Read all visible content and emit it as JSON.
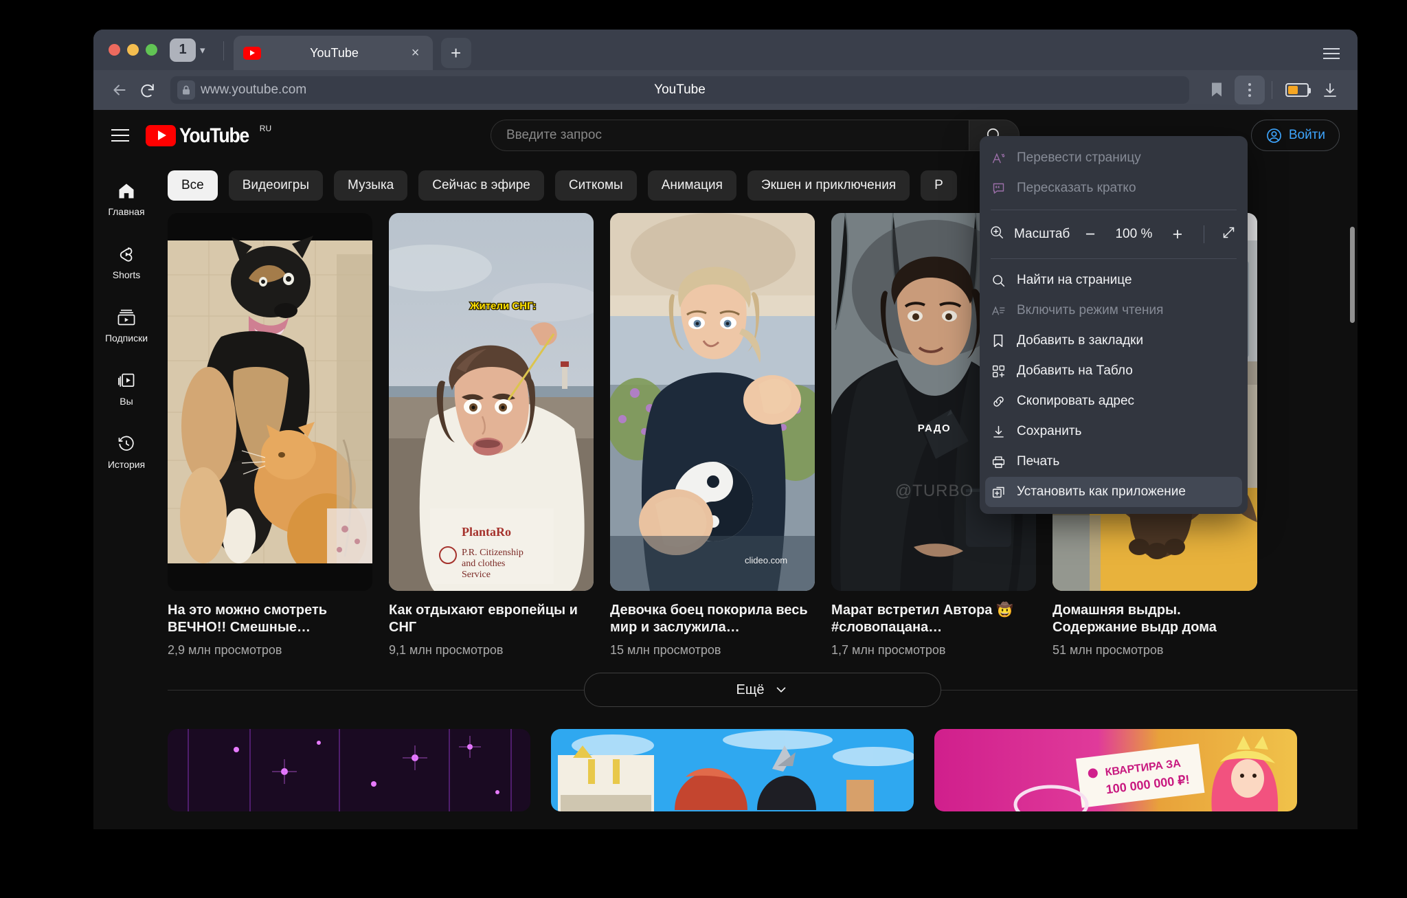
{
  "browser": {
    "tab_count": "1",
    "tab_title": "YouTube",
    "tab_close_label": "×",
    "new_tab_label": "+",
    "url": "www.youtube.com",
    "page_name": "YouTube",
    "icons": {
      "back": "back-arrow-icon",
      "reload": "reload-icon",
      "lock": "lock-icon",
      "bookmark": "bookmark-icon",
      "kebab": "more-options-icon",
      "battery": "battery-icon",
      "download": "download-icon",
      "window_menu": "window-menu-icon",
      "tab_count_chevron": "chevron-down-icon"
    }
  },
  "menu": {
    "items": [
      {
        "label": "Перевести страницу",
        "icon": "translate-icon",
        "state": "disabled"
      },
      {
        "label": "Пересказать кратко",
        "icon": "summarize-icon",
        "state": "disabled"
      },
      {
        "label": "Найти на странице",
        "icon": "search-icon",
        "state": "normal"
      },
      {
        "label": "Включить режим чтения",
        "icon": "reader-mode-icon",
        "state": "disabled"
      },
      {
        "label": "Добавить в закладки",
        "icon": "bookmark-icon",
        "state": "normal"
      },
      {
        "label": "Добавить на Табло",
        "icon": "add-to-dashboard-icon",
        "state": "normal"
      },
      {
        "label": "Скопировать адрес",
        "icon": "link-icon",
        "state": "normal"
      },
      {
        "label": "Сохранить",
        "icon": "download-icon",
        "state": "normal"
      },
      {
        "label": "Печать",
        "icon": "printer-icon",
        "state": "normal"
      },
      {
        "label": "Установить как приложение",
        "icon": "install-app-icon",
        "state": "highlighted"
      }
    ],
    "zoom": {
      "label": "Масштаб",
      "value": "100 %",
      "minus": "−",
      "plus": "+",
      "icon": "zoom-icon",
      "fullscreen_icon": "fullscreen-icon"
    }
  },
  "youtube": {
    "logo_word": "YouTube",
    "logo_region": "RU",
    "search": {
      "placeholder": "Введите запрос",
      "button_icon": "search-icon"
    },
    "signin": {
      "label": "Войти",
      "icon": "account-circle-icon"
    },
    "sidebar": [
      {
        "label": "Главная",
        "icon": "home-icon"
      },
      {
        "label": "Shorts",
        "icon": "shorts-icon"
      },
      {
        "label": "Подписки",
        "icon": "subscriptions-icon"
      },
      {
        "label": "Вы",
        "icon": "you-library-icon"
      },
      {
        "label": "История",
        "icon": "history-icon"
      }
    ],
    "chips": [
      {
        "label": "Все",
        "selected": true
      },
      {
        "label": "Видеоигры",
        "selected": false
      },
      {
        "label": "Музыка",
        "selected": false
      },
      {
        "label": "Сейчас в эфире",
        "selected": false
      },
      {
        "label": "Ситкомы",
        "selected": false
      },
      {
        "label": "Анимация",
        "selected": false
      },
      {
        "label": "Экшен и приключения",
        "selected": false
      },
      {
        "label": "Р",
        "selected": false
      }
    ],
    "videos": [
      {
        "title": "На это можно смотреть ВЕЧНО!! Смешные…",
        "views": "2,9 млн просмотров",
        "overlay_text": ""
      },
      {
        "title": "Как отдыхают европейцы и СНГ",
        "views": "9,1 млн просмотров",
        "overlay_text": "Жители СНГ:"
      },
      {
        "title": "Девочка боец покорила весь мир и заслужила…",
        "views": "15 млн просмотров",
        "overlay_text": "clideo.com"
      },
      {
        "title": "Марат встретил Автора 🤠 #словопацана…",
        "views": "1,7 млн просмотров",
        "overlay_text": "РАДО"
      },
      {
        "title": "Домашняя выдры. Содержание выдр дома",
        "views": "51 млн просмотров",
        "overlay_text": ""
      }
    ],
    "more_button": {
      "label": "Ещё",
      "icon": "chevron-down-icon"
    },
    "shelf_overlay": "КВАРТИРА ЗА 100 000 000 ₽!"
  },
  "colors": {
    "brand_red": "#ff0000",
    "accent_blue": "#3ea6ff",
    "page_bg": "#0f0f0f",
    "chrome_bg": "#3a3f4b",
    "menu_bg": "#32363f",
    "battery_fill": "#f5a623",
    "annotation_arrow": "#f5252c"
  }
}
